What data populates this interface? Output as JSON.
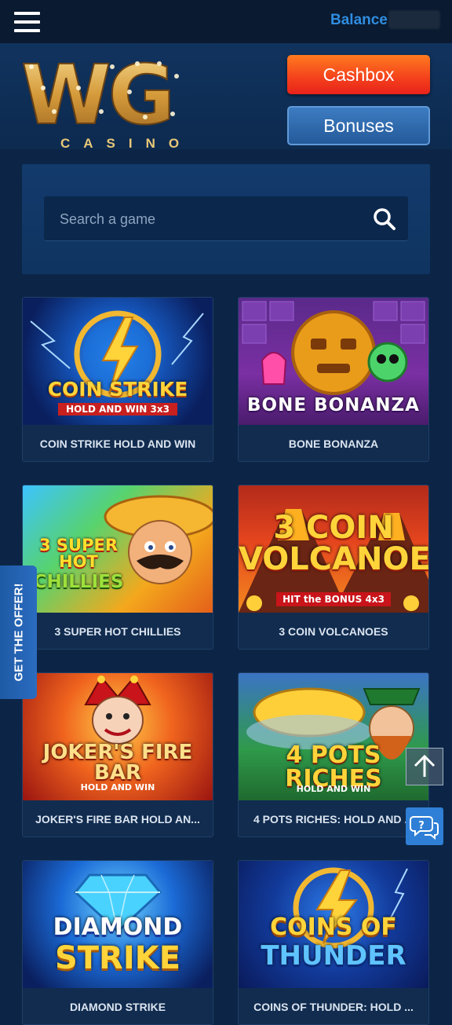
{
  "topbar": {
    "balance_label": "Balance",
    "menu_icon": "hamburger-menu-icon"
  },
  "logo": {
    "main": "WG",
    "sub": "CASINO"
  },
  "buttons": {
    "cashbox": "Cashbox",
    "bonuses": "Bonuses"
  },
  "search": {
    "placeholder": "Search a game",
    "icon": "search-icon"
  },
  "games": [
    {
      "title": "COIN STRIKE HOLD AND WIN",
      "art_line1": "COIN STRIKE",
      "art_line2": "HOLD AND WIN 3x3"
    },
    {
      "title": "BONE BONANZA",
      "art_line1": "BONE BONANZA",
      "art_line2": ""
    },
    {
      "title": "3 SUPER HOT CHILLIES",
      "art_line1": "3 SUPER HOT",
      "art_line2": "CHILLIES"
    },
    {
      "title": "3 COIN VOLCANOES",
      "art_line1": "3 COIN VOLCANOES",
      "art_line2": "HIT the BONUS 4x3"
    },
    {
      "title": "JOKER'S FIRE BAR HOLD AN...",
      "art_line1": "JOKER'S FIRE BAR",
      "art_line2": "HOLD AND WIN"
    },
    {
      "title": "4 POTS RICHES: HOLD AND ...",
      "art_line1": "4 POTS RICHES",
      "art_line2": "HOLD AND WIN"
    },
    {
      "title": "DIAMOND STRIKE",
      "art_line1": "DIAMOND",
      "art_line2": "STRIKE"
    },
    {
      "title": "COINS OF THUNDER: HOLD ...",
      "art_line1": "COINS OF",
      "art_line2": "THUNDER"
    }
  ],
  "offer_tab": "GET THE OFFER!",
  "floating": {
    "scroll_top_icon": "arrow-up-icon",
    "support_icon": "chat-support-icon"
  },
  "colors": {
    "accent_blue": "#2f8de0",
    "cashbox_orange": "#f4401c",
    "bonuses_blue": "#245a9a",
    "background": "#0c2546"
  }
}
